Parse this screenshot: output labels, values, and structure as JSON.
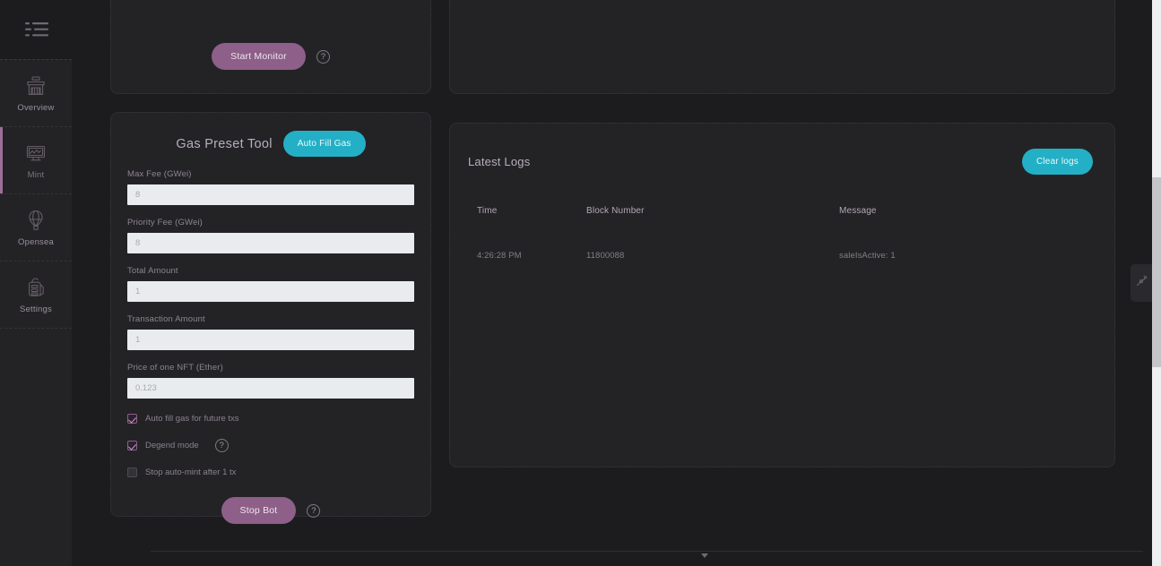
{
  "topbar": {
    "menu_icon": "list-menu-icon",
    "toggle": {
      "name": "theme-toggle",
      "state": "on"
    },
    "fullscreen_icon": "fullscreen-expand-icon"
  },
  "sidebar": {
    "items": [
      {
        "label": "Overview",
        "icon": "store-icon",
        "active": false
      },
      {
        "label": "Mint",
        "icon": "monitor-icon",
        "active": true
      },
      {
        "label": "Opensea",
        "icon": "hot-air-balloon-icon",
        "active": false
      },
      {
        "label": "Settings",
        "icon": "backpack-icon",
        "active": false
      }
    ]
  },
  "monitor_card": {
    "start_button": "Start Monitor",
    "help_icon": "?"
  },
  "gas_card": {
    "title": "Gas Preset Tool",
    "auto_fill_button": "Auto Fill Gas",
    "fields": [
      {
        "label": "Max Fee (GWei)",
        "placeholder": "8",
        "value": ""
      },
      {
        "label": "Priority Fee (GWei)",
        "placeholder": "8",
        "value": ""
      },
      {
        "label": "Total Amount",
        "placeholder": "1",
        "value": ""
      },
      {
        "label": "Transaction Amount",
        "placeholder": "1",
        "value": ""
      },
      {
        "label": "Price of one NFT (Ether)",
        "placeholder": "0.123",
        "value": ""
      }
    ],
    "checkboxes": [
      {
        "label": "Auto fill gas for future txs",
        "checked": true,
        "disabled": false,
        "help": false
      },
      {
        "label": "Degend mode",
        "checked": true,
        "disabled": false,
        "help": true
      },
      {
        "label": "Stop auto-mint after 1 tx",
        "checked": false,
        "disabled": true,
        "help": false
      }
    ],
    "stop_button": "Stop Bot",
    "help_icon": "?"
  },
  "logs_card": {
    "title": "Latest Logs",
    "clear_button": "Clear logs",
    "columns": [
      "Time",
      "Block Number",
      "Message"
    ],
    "rows": [
      {
        "time": "4:26:28 PM",
        "block": "11800088",
        "message": "saleIsActive: 1"
      }
    ]
  },
  "tool_tab": {
    "icon": "wrench-icon"
  },
  "colors": {
    "background": "#1c1c1e",
    "card": "#232326",
    "accent_purple": "#8d5f89",
    "accent_teal": "#23b0c6",
    "input_bg": "#e9ecef",
    "text_muted": "#8a818c"
  }
}
